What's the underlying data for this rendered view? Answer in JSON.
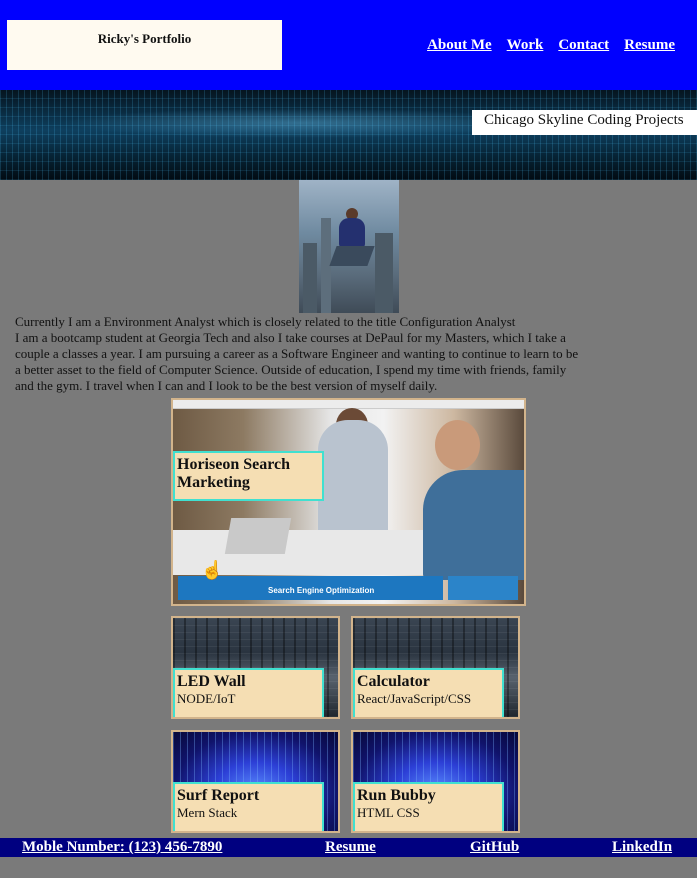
{
  "header": {
    "logo_text": "Ricky's Portfolio",
    "nav": [
      "About Me",
      "Work",
      "Contact",
      "Resume"
    ]
  },
  "hero": {
    "label": "Chicago Skyline Coding Projects"
  },
  "about": {
    "line1": "Currently I am a Environment Analyst which is closely related to the title Configuration Analyst",
    "paragraph": "I am a bootcamp student at Georgia Tech and also I take courses at DePaul for my Masters, which I take a couple a classes a year. I am pursuing a career as a Software Engineer and wanting to continue to learn to be a better asset to the field of Computer Science. Outside of education, I spend my time with friends, family and the gym. I travel when I can and I look to be the best version of myself daily."
  },
  "projects": {
    "featured": {
      "title": "Horiseon Search Marketing",
      "banner": "Search Engine Optimization"
    },
    "items": [
      {
        "title": "LED Wall",
        "subtitle": "NODE/IoT"
      },
      {
        "title": "Calculator",
        "subtitle": "React/JavaScript/CSS"
      },
      {
        "title": "Surf Report",
        "subtitle": "Mern Stack"
      },
      {
        "title": "Run Bubby",
        "subtitle": "HTML CSS"
      }
    ]
  },
  "footer": {
    "phone": "Moble Number: (123) 456-7890",
    "resume": "Resume",
    "github": "GitHub",
    "linkedin": "LinkedIn"
  },
  "colors": {
    "header_bg": "#0000ff",
    "page_bg": "#7a7a7a",
    "footer_bg": "#000080",
    "card_label_bg": "#f5deb3",
    "card_label_border": "#40e0d0"
  }
}
